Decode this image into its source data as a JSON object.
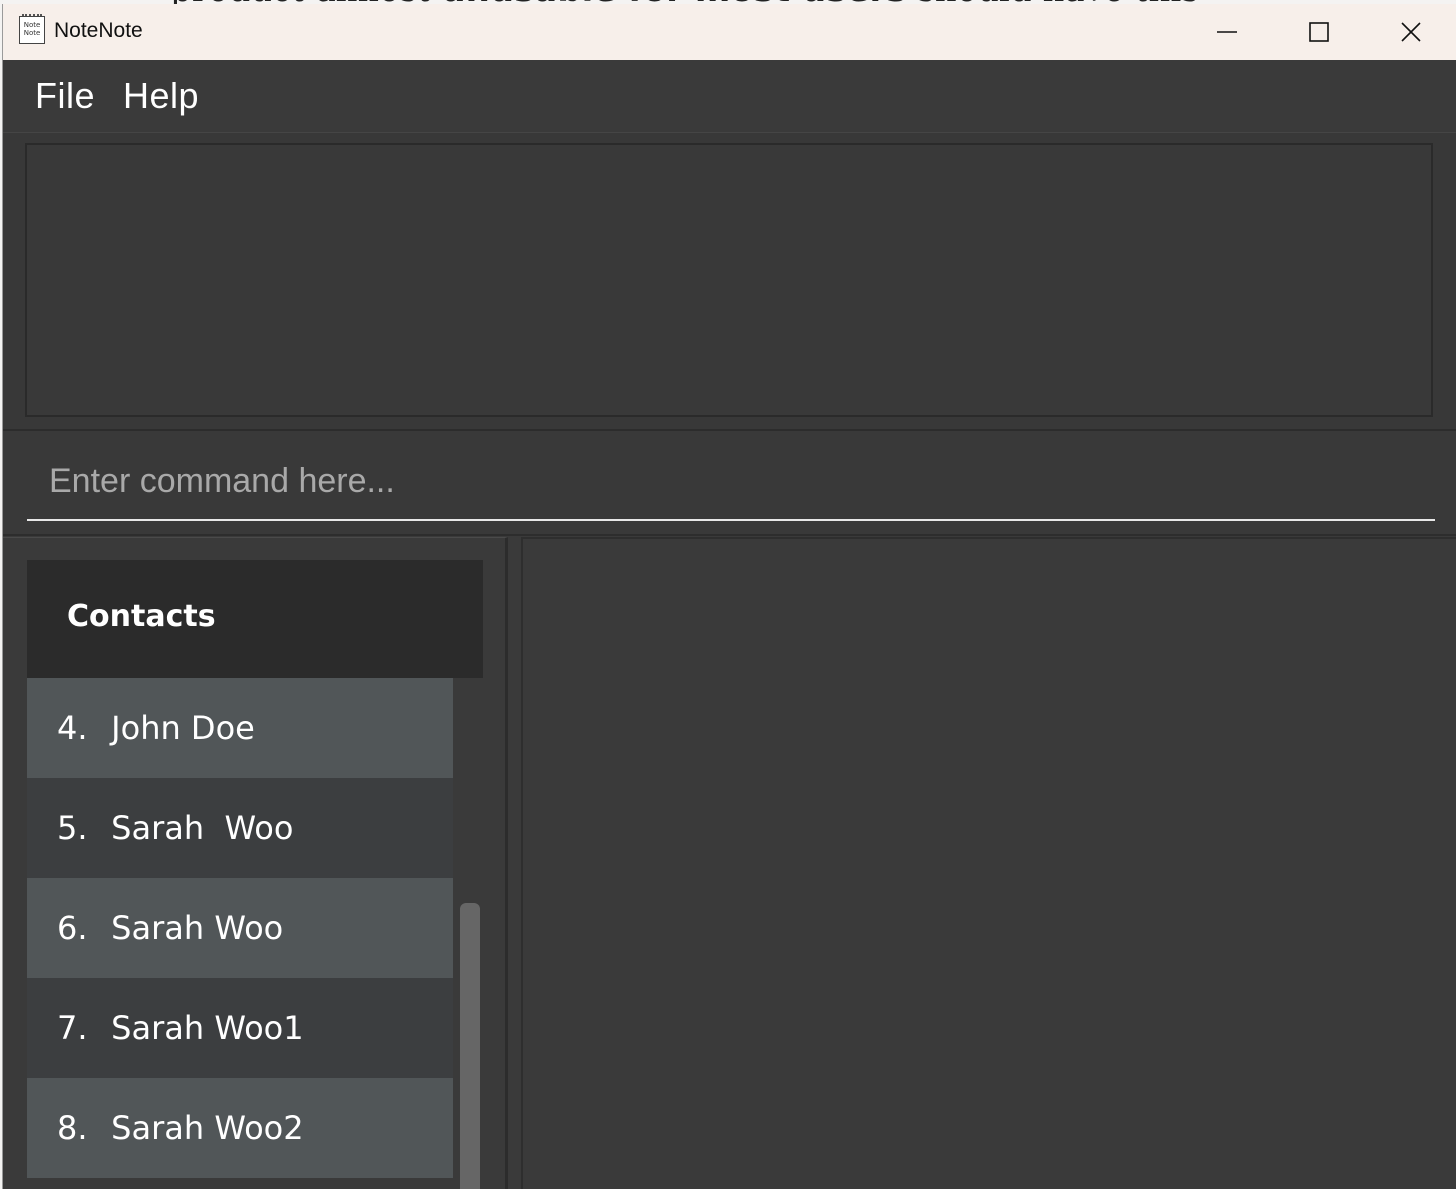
{
  "window": {
    "title": "NoteNote",
    "icon_label": "Note Note"
  },
  "menu": {
    "file": "File",
    "help": "Help"
  },
  "result_display": {
    "text": ""
  },
  "command_box": {
    "placeholder": "Enter command here...",
    "value": ""
  },
  "contacts": {
    "header": "Contacts",
    "items": [
      {
        "index": "4.",
        "name": "John Doe"
      },
      {
        "index": "5.",
        "name": "Sarah  Woo"
      },
      {
        "index": "6.",
        "name": "Sarah Woo"
      },
      {
        "index": "7.",
        "name": "Sarah Woo1"
      },
      {
        "index": "8.",
        "name": "Sarah Woo2"
      }
    ]
  },
  "colors": {
    "titlebar": "#f7efea",
    "background": "#3a3a3a",
    "row_highlight": "#515658",
    "row_alternate": "#3c3e40",
    "header": "#2b2b2b"
  },
  "icons": {
    "minimize": "minimize-icon",
    "maximize": "maximize-icon",
    "close": "close-icon",
    "app": "notenote-app-icon"
  }
}
